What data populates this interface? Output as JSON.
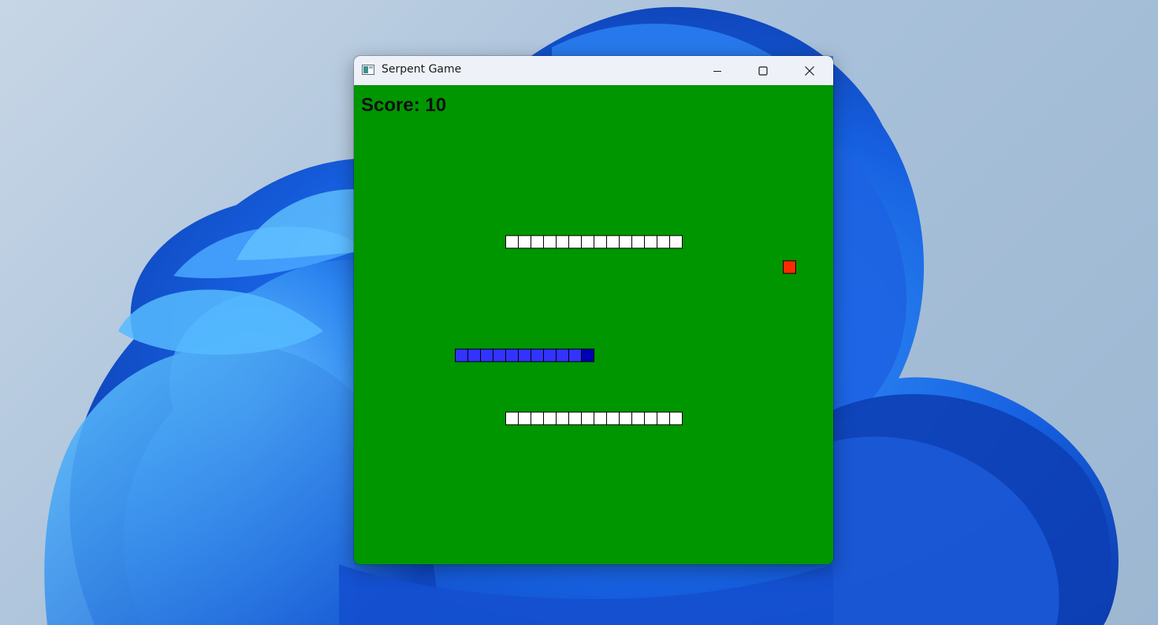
{
  "window": {
    "title": "Serpent Game",
    "icon": "app-window-icon",
    "controls": {
      "minimize_icon": "minimize-icon",
      "maximize_icon": "maximize-icon",
      "close_icon": "close-icon"
    }
  },
  "game": {
    "score_text": "Score: 10",
    "colors": {
      "field": "#009600",
      "wall_segment": "#ffffff",
      "snake_body": "#3333ff",
      "snake_head": "#0000b4",
      "food": "#ff2a00",
      "outline": "#000000"
    }
  }
}
